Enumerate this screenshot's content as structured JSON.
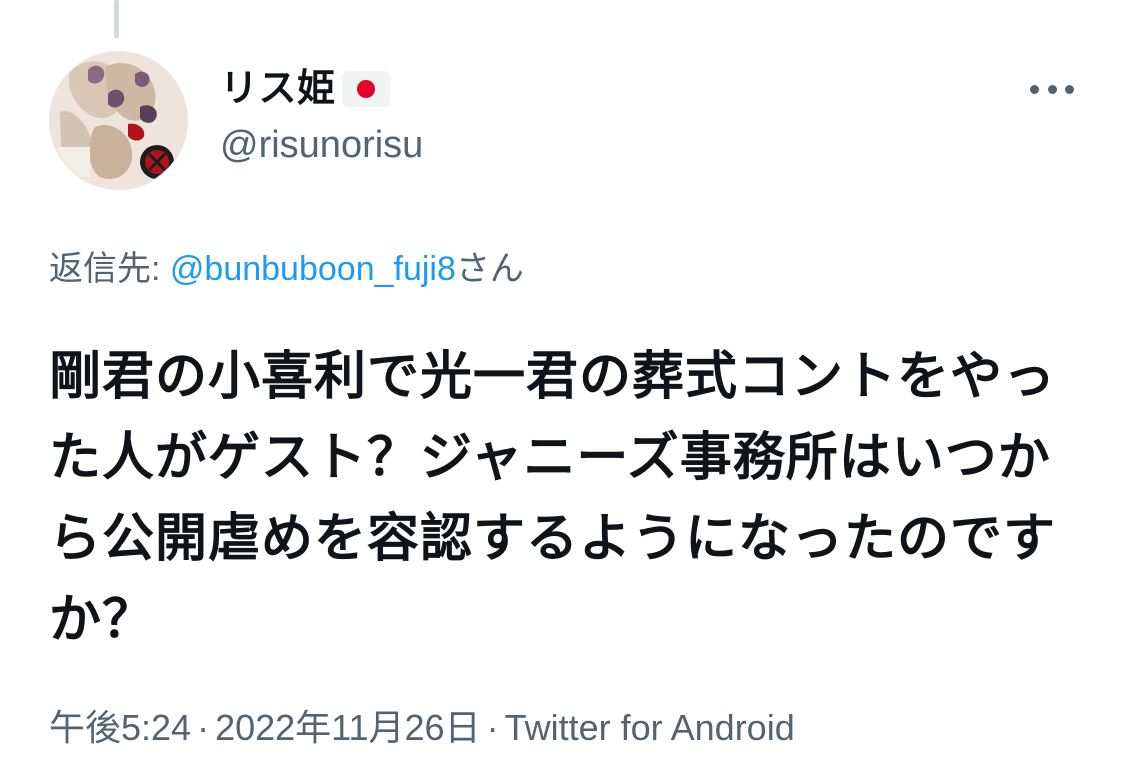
{
  "user": {
    "display_name": "リス姫",
    "handle": "@risunorisu",
    "flag_icon": "japan-flag-icon",
    "flag_colors": {
      "red": "#e3002b",
      "white": "#ffffff"
    }
  },
  "menu": {
    "icon": "more-horizontal-icon"
  },
  "reply_context": {
    "prefix": "返信先: ",
    "mention": "@bunbuboon_fuji8",
    "suffix": "さん"
  },
  "tweet": {
    "text": "剛君の小喜利で光一君の葬式コントをやった人がゲスト？ジャニーズ事務所はいつから公開虐めを容認するようになったのですか？"
  },
  "meta": {
    "time": "午後5:24",
    "separator": "·",
    "date": "2022年11月26日",
    "source": "Twitter for Android"
  },
  "colors": {
    "text_primary": "#0f1419",
    "text_secondary": "#536471",
    "link": "#1d9bf0",
    "thread_line": "#cfd9de"
  }
}
